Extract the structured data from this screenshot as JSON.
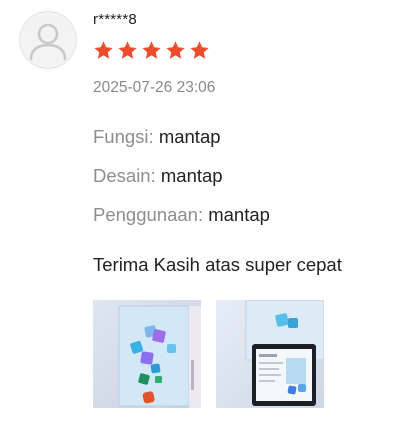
{
  "review": {
    "username": "r*****8",
    "rating": 5,
    "rating_max": 5,
    "star_color": "#ee4d2d",
    "timestamp": "2025-07-26 23:06",
    "attributes": [
      {
        "key": "Fungsi:",
        "value": "mantap"
      },
      {
        "key": "Desain:",
        "value": "mantap"
      },
      {
        "key": "Penggunaan:",
        "value": "mantap"
      }
    ],
    "comment": "Terima Kasih atas super cepat",
    "photos": [
      "review-photo-1",
      "review-photo-2"
    ]
  },
  "icons": {
    "avatar": "user-silhouette-icon",
    "star": "star-icon"
  }
}
